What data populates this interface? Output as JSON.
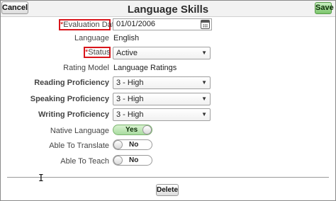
{
  "header": {
    "title": "Language Skills",
    "cancel_label": "Cancel",
    "save_label": "Save"
  },
  "form": {
    "evaluation_date": {
      "label": "Evaluation Date",
      "value": "01/01/2006"
    },
    "language": {
      "label": "Language",
      "value": "English"
    },
    "status": {
      "label": "Status",
      "value": "Active"
    },
    "rating_model": {
      "label": "Rating Model",
      "value": "Language Ratings"
    },
    "reading_proficiency": {
      "label": "Reading Proficiency",
      "value": "3 - High"
    },
    "speaking_proficiency": {
      "label": "Speaking Proficiency",
      "value": "3 - High"
    },
    "writing_proficiency": {
      "label": "Writing Proficiency",
      "value": "3 - High"
    },
    "native_language": {
      "label": "Native Language",
      "value": "Yes"
    },
    "able_to_translate": {
      "label": "Able To Translate",
      "value": "No"
    },
    "able_to_teach": {
      "label": "Able To Teach",
      "value": "No"
    }
  },
  "footer": {
    "delete_label": "Delete"
  },
  "icons": {
    "calendar": "calendar-icon",
    "dropdown": "chevron-down-icon",
    "cursor": "text-cursor-icon"
  },
  "colors": {
    "required_highlight": "#d8151b",
    "save_button": "#7cc56c",
    "toggle_on": "#a9dca0"
  }
}
